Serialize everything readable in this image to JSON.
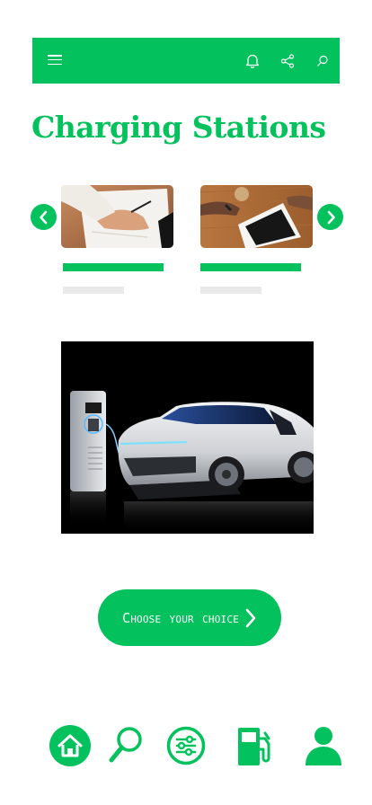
{
  "header": {
    "icons": [
      "menu-icon",
      "bell-icon",
      "share-icon",
      "search-icon"
    ]
  },
  "page": {
    "title": "Charging Stations"
  },
  "carousel": {
    "cards": [
      {
        "image": "hand-writing-on-paper-photo"
      },
      {
        "image": "hands-using-tablet-photo"
      }
    ]
  },
  "hero": {
    "image": "electric-car-at-charging-station-photo"
  },
  "cta": {
    "label": "Choose your choice"
  },
  "bottom_nav": {
    "icons": [
      "home-icon",
      "search-icon",
      "filter-sliders-icon",
      "fuel-pump-icon",
      "user-icon"
    ]
  },
  "colors": {
    "accent": "#03c15c",
    "placeholder": "#e9e9e9",
    "background": "#ffffff"
  }
}
